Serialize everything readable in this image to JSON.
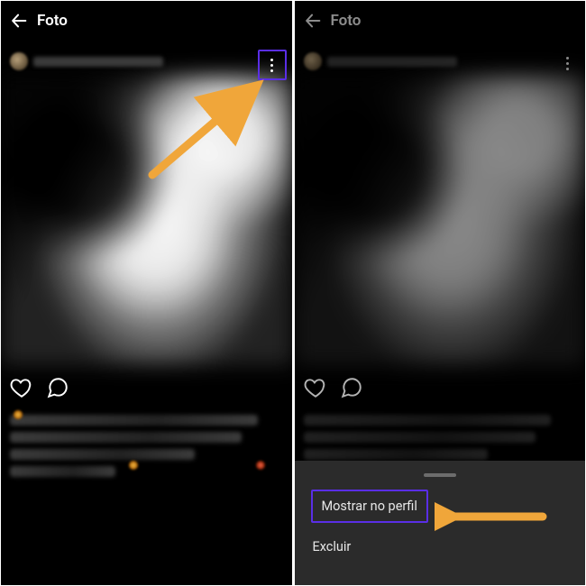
{
  "colors": {
    "highlight_border": "#5a2ee6",
    "arrow": "#f0a63a",
    "sheet_bg": "#2b2b2b"
  },
  "left": {
    "header": {
      "title": "Foto"
    }
  },
  "right": {
    "header": {
      "title": "Foto"
    },
    "sheet": {
      "show_on_profile": "Mostrar no perfil",
      "delete": "Excluir"
    }
  }
}
